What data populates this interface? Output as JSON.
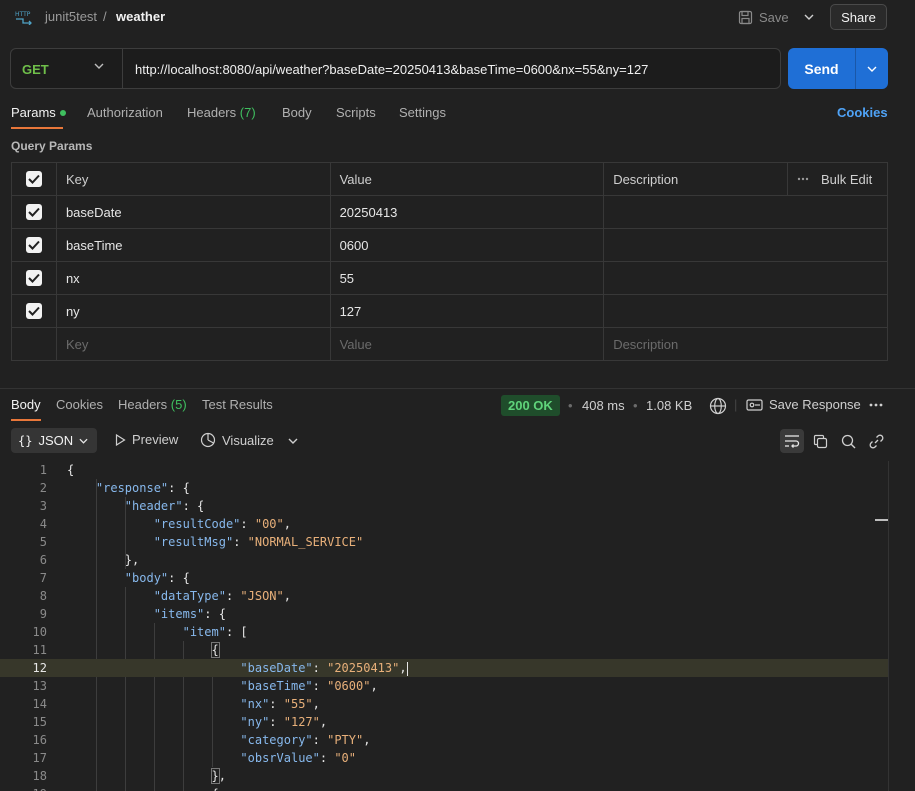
{
  "breadcrumb": {
    "collection": "junit5test",
    "separator": "/",
    "request": "weather"
  },
  "header_actions": {
    "save_label": "Save",
    "share_label": "Share"
  },
  "request": {
    "method": "GET",
    "url": "http://localhost:8080/api/weather?baseDate=20250413&baseTime=0600&nx=55&ny=127",
    "send_label": "Send"
  },
  "request_tabs": {
    "params": "Params",
    "authorization": "Authorization",
    "headers": "Headers",
    "headers_count": "(7)",
    "body": "Body",
    "scripts": "Scripts",
    "settings": "Settings",
    "cookies": "Cookies"
  },
  "query_params": {
    "title": "Query Params",
    "headers": {
      "key": "Key",
      "value": "Value",
      "description": "Description",
      "bulk_edit": "Bulk Edit"
    },
    "rows": [
      {
        "key": "baseDate",
        "value": "20250413"
      },
      {
        "key": "baseTime",
        "value": "0600"
      },
      {
        "key": "nx",
        "value": "55"
      },
      {
        "key": "ny",
        "value": "127"
      }
    ],
    "placeholder": {
      "key": "Key",
      "value": "Value",
      "description": "Description"
    }
  },
  "response_tabs": {
    "body": "Body",
    "cookies": "Cookies",
    "headers": "Headers",
    "headers_count": "(5)",
    "test_results": "Test Results"
  },
  "response_meta": {
    "status": "200 OK",
    "time": "408 ms",
    "size": "1.08 KB",
    "save_response": "Save Response"
  },
  "response_toolbar": {
    "format": "JSON",
    "preview": "Preview",
    "visualize": "Visualize"
  },
  "code_lines": [
    "1",
    "2",
    "3",
    "4",
    "5",
    "6",
    "7",
    "8",
    "9",
    "10",
    "11",
    "12",
    "13",
    "14",
    "15",
    "16",
    "17",
    "18"
  ],
  "code": {
    "response_key": "\"response\"",
    "header_key": "\"header\"",
    "resultCode_key": "\"resultCode\"",
    "resultCode_val": "\"00\"",
    "resultMsg_key": "\"resultMsg\"",
    "resultMsg_val": "\"NORMAL_SERVICE\"",
    "body_key": "\"body\"",
    "dataType_key": "\"dataType\"",
    "dataType_val": "\"JSON\"",
    "items_key": "\"items\"",
    "item_key": "\"item\"",
    "baseDate_key": "\"baseDate\"",
    "baseDate_val": "\"20250413\"",
    "baseTime_key": "\"baseTime\"",
    "baseTime_val": "\"0600\"",
    "nx_key": "\"nx\"",
    "nx_val": "\"55\"",
    "ny_key": "\"ny\"",
    "ny_val": "\"127\"",
    "category_key": "\"category\"",
    "category_val": "\"PTY\"",
    "obsrValue_key": "\"obsrValue\"",
    "obsrValue_val": "\"0\""
  }
}
